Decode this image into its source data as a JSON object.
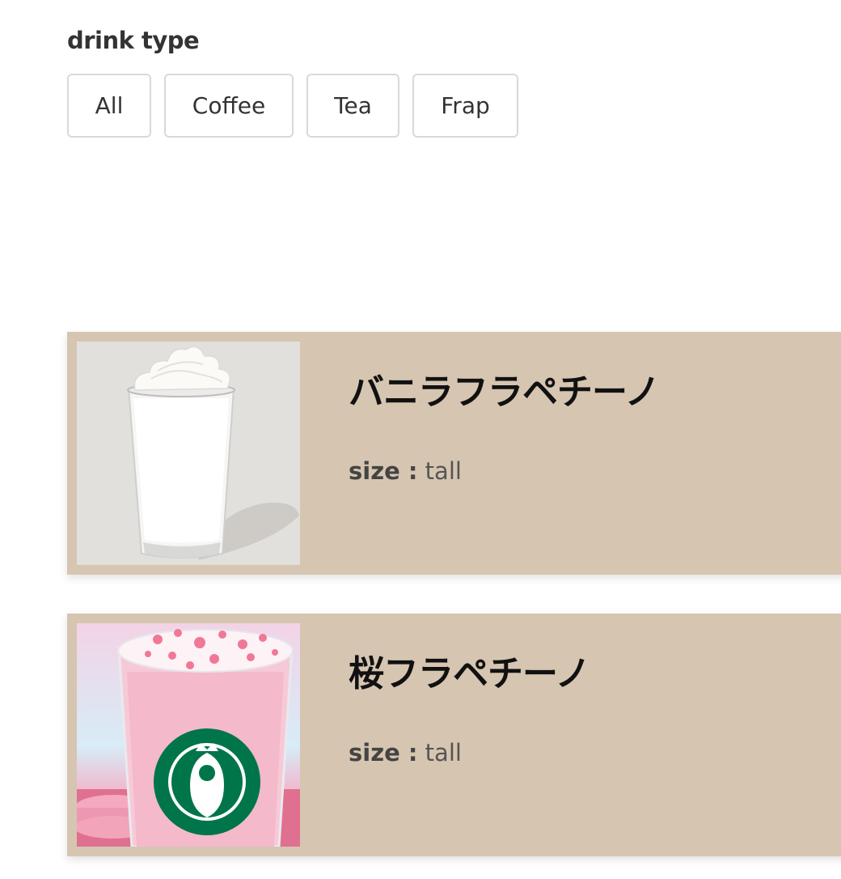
{
  "filter": {
    "title": "drink type",
    "buttons": [
      {
        "label": "All"
      },
      {
        "label": "Coffee"
      },
      {
        "label": "Tea"
      },
      {
        "label": "Frap"
      }
    ]
  },
  "drinks": [
    {
      "name": "バニラフラペチーノ",
      "size_label": "size :",
      "size_value": "tall",
      "image_icon": "vanilla-frappuccino-photo"
    },
    {
      "name": "桜フラペチーノ",
      "size_label": "size :",
      "size_value": "tall",
      "image_icon": "sakura-frappuccino-photo"
    }
  ],
  "colors": {
    "card_background": "#d6c5b1",
    "button_border": "#d9d9d9",
    "text": "#333333"
  }
}
